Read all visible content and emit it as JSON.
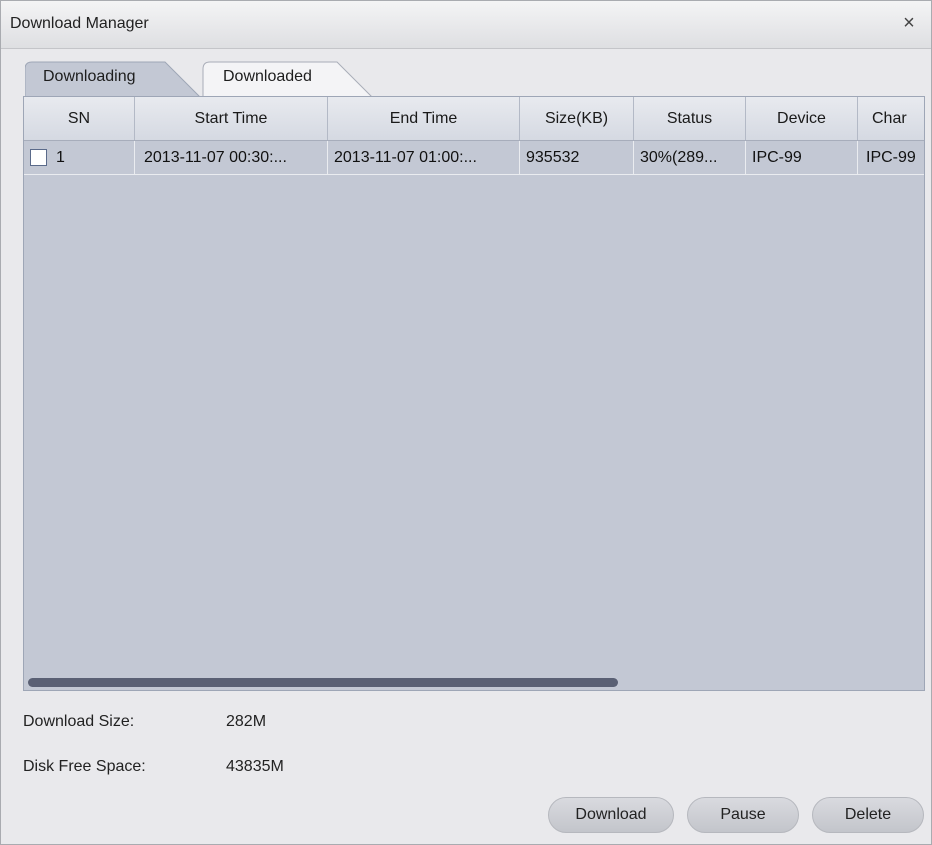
{
  "window": {
    "title": "Download Manager",
    "close_symbol": "×"
  },
  "tabs": [
    {
      "label": "Downloading",
      "active": true
    },
    {
      "label": "Downloaded",
      "active": false
    }
  ],
  "table": {
    "columns": [
      "SN",
      "Start Time",
      "End Time",
      "Size(KB)",
      "Status",
      "Device",
      "Char"
    ],
    "rows": [
      {
        "checked": false,
        "sn": "1",
        "start_time": "2013-11-07 00:30:...",
        "end_time": "2013-11-07 01:00:...",
        "size_kb": "935532",
        "status": "30%(289...",
        "device": "IPC-99",
        "channel": "IPC-99"
      }
    ],
    "horizontal_scroll_fraction": 0.66
  },
  "info": {
    "download_size_label": "Download Size:",
    "download_size_value": "282M",
    "disk_free_label": "Disk Free Space:",
    "disk_free_value": "43835M"
  },
  "buttons": {
    "download": "Download",
    "pause": "Pause",
    "delete": "Delete"
  },
  "colors": {
    "grid_background": "#c3c8d4",
    "scroll_thumb": "#5a6074",
    "window_background": "#e9e9ec"
  }
}
